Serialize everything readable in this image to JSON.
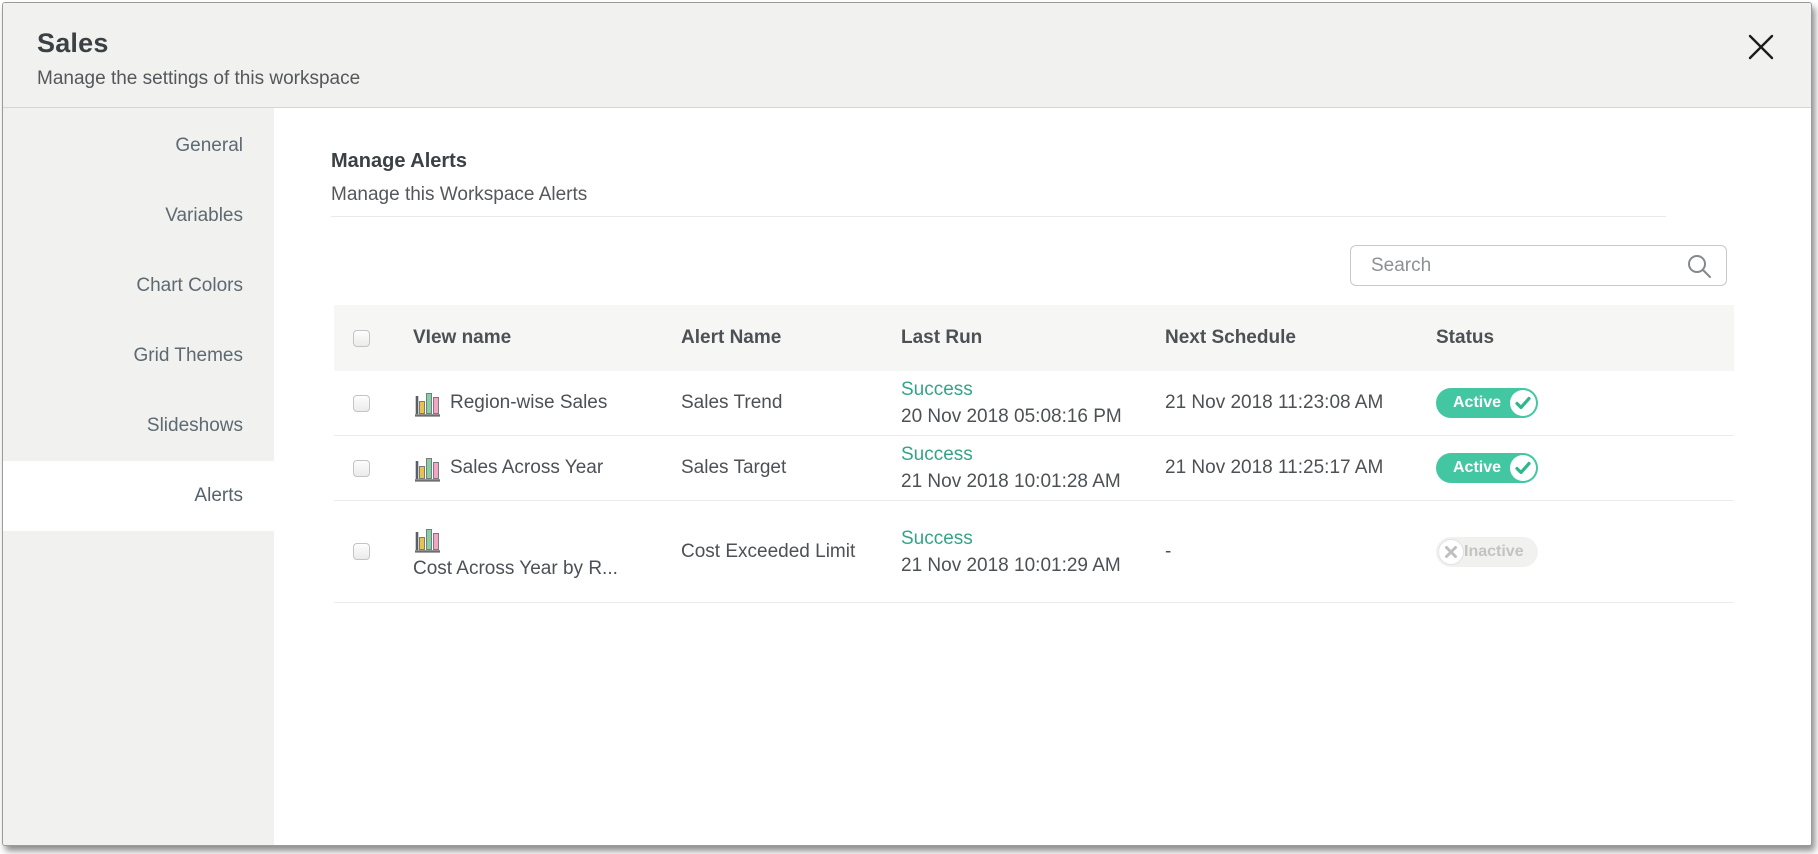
{
  "dialog": {
    "title": "Sales",
    "subtitle": "Manage the settings of this workspace"
  },
  "sidebar": {
    "items": [
      {
        "label": "General",
        "active": false
      },
      {
        "label": "Variables",
        "active": false
      },
      {
        "label": "Chart Colors",
        "active": false
      },
      {
        "label": "Grid Themes",
        "active": false
      },
      {
        "label": "Slideshows",
        "active": false
      },
      {
        "label": "Alerts",
        "active": true
      }
    ]
  },
  "main": {
    "heading": "Manage Alerts",
    "subheading": "Manage this Workspace Alerts",
    "search": {
      "placeholder": "Search",
      "value": ""
    }
  },
  "table": {
    "headers": [
      "VIew name",
      "Alert Name",
      "Last Run",
      "Next Schedule",
      "Status"
    ],
    "rows": [
      {
        "view_name": "Region-wise Sales",
        "alert_name": "Sales Trend",
        "last_run_status": "Success",
        "last_run_time": "20 Nov 2018 05:08:16 PM",
        "next_schedule": "21 Nov 2018 11:23:08 AM",
        "status": "Active"
      },
      {
        "view_name": "Sales Across Year",
        "alert_name": "Sales Target",
        "last_run_status": "Success",
        "last_run_time": "21 Nov 2018 10:01:28 AM",
        "next_schedule": "21 Nov 2018 11:25:17 AM",
        "status": "Active"
      },
      {
        "view_name": "Cost Across Year by R...",
        "alert_name": "Cost Exceeded Limit",
        "last_run_status": "Success",
        "last_run_time": "21 Nov 2018 10:01:29 AM",
        "next_schedule": "-",
        "status": "Inactive"
      }
    ]
  },
  "colors": {
    "active_badge": "#42c7a2",
    "success_text": "#36a388",
    "header_bg": "#f1f1ef",
    "table_header_bg": "#f6f6f5"
  },
  "icons": {
    "close": "close-icon",
    "search": "search-icon",
    "view": "bar-chart-icon",
    "active": "check-icon",
    "inactive": "x-icon"
  }
}
